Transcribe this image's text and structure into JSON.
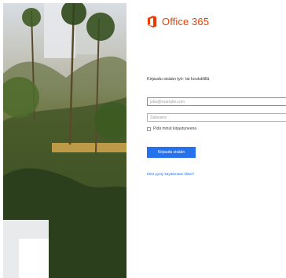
{
  "brand": {
    "name": "Office 365",
    "color": "#eb3c00",
    "icon": "office-logo-icon"
  },
  "login": {
    "prompt": "Kirjaudu sisään työ- tai koulutilillä",
    "username_placeholder": "joku@example.com",
    "password_placeholder": "Salasana",
    "remember_label": "Pidä minut kirjautuneena",
    "signin_label": "Kirjaudu sisään",
    "help_link": "Etkö pysty käyttämään tiliäsi?",
    "accent": "#2672ec"
  }
}
